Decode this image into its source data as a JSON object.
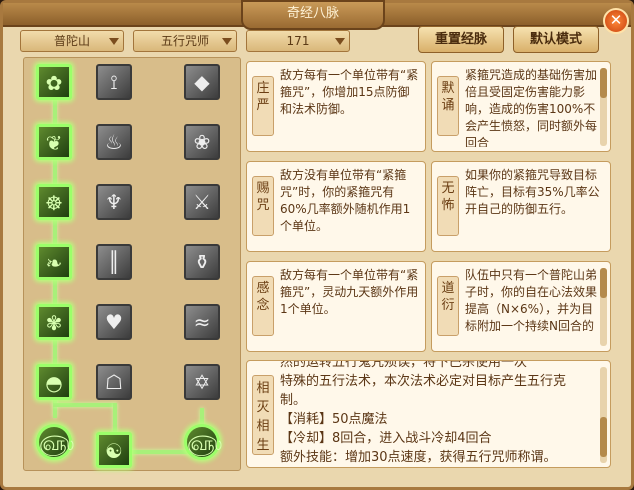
{
  "window": {
    "title": "奇经八脉",
    "close": "✕"
  },
  "filters": {
    "school": "普陀山",
    "category": "五行咒师",
    "value": "171"
  },
  "buttons": {
    "reset": "重置经脉",
    "default": "默认模式"
  },
  "tree_icons": {
    "rows": [
      [
        "lotus-icon",
        "claw-icon",
        "scroll-icon"
      ],
      [
        "vine-icon",
        "chalice-icon",
        "lotus-bowl-icon"
      ],
      [
        "seated-buddha-icon",
        "meditator-icon",
        "sweep-icon"
      ],
      [
        "leaf-icon",
        "bamboo-icon",
        "stupa-icon"
      ],
      [
        "flower-icon",
        "hearts-icon",
        "wave-icon"
      ],
      [
        "stone-icon",
        "pagoda-icon",
        "pentagram-icon"
      ],
      [
        "spiral-icon",
        "taiji-icon",
        "spiral-right-icon"
      ]
    ]
  },
  "skills": [
    {
      "tag": "庄严",
      "text": "敌方每有一个单位带有“紧箍咒”，你增加15点防御和法术防御。"
    },
    {
      "tag": "默诵",
      "text": "紧箍咒造成的基础伤害加倍且受固定伤害能力影响，造成的伤害100%不会产生愤怒，同时额外每回合"
    },
    {
      "tag": "赐咒",
      "text": "敌方没有单位带有“紧箍咒”时，你的紧箍咒有60%几率额外随机作用1个单位。"
    },
    {
      "tag": "无怖",
      "text": "如果你的紧箍咒导致目标阵亡，目标有35%几率公开自己的防御五行。"
    },
    {
      "tag": "感念",
      "text": "敌方每有一个单位带有“紧箍咒”，灵动九天额外作用1个单位。"
    },
    {
      "tag": "道衍",
      "text": "队伍中只有一个普陀山弟子时，你的自在心法效果提高（N×6%），并为目标附加一个持续N回合的"
    },
    {
      "tag": "相灭相生",
      "lines": [
        "然的运转五行鬼咒殒误，将下巴杀使用一次",
        "特殊的五行法术，本次法术必定对目标产生五行克",
        "制。",
        "【消耗】50点魔法",
        "【冷却】8回合，进入战斗冷却4回合",
        "额外技能：增加30点速度，获得五行咒师称谓。"
      ]
    }
  ]
}
